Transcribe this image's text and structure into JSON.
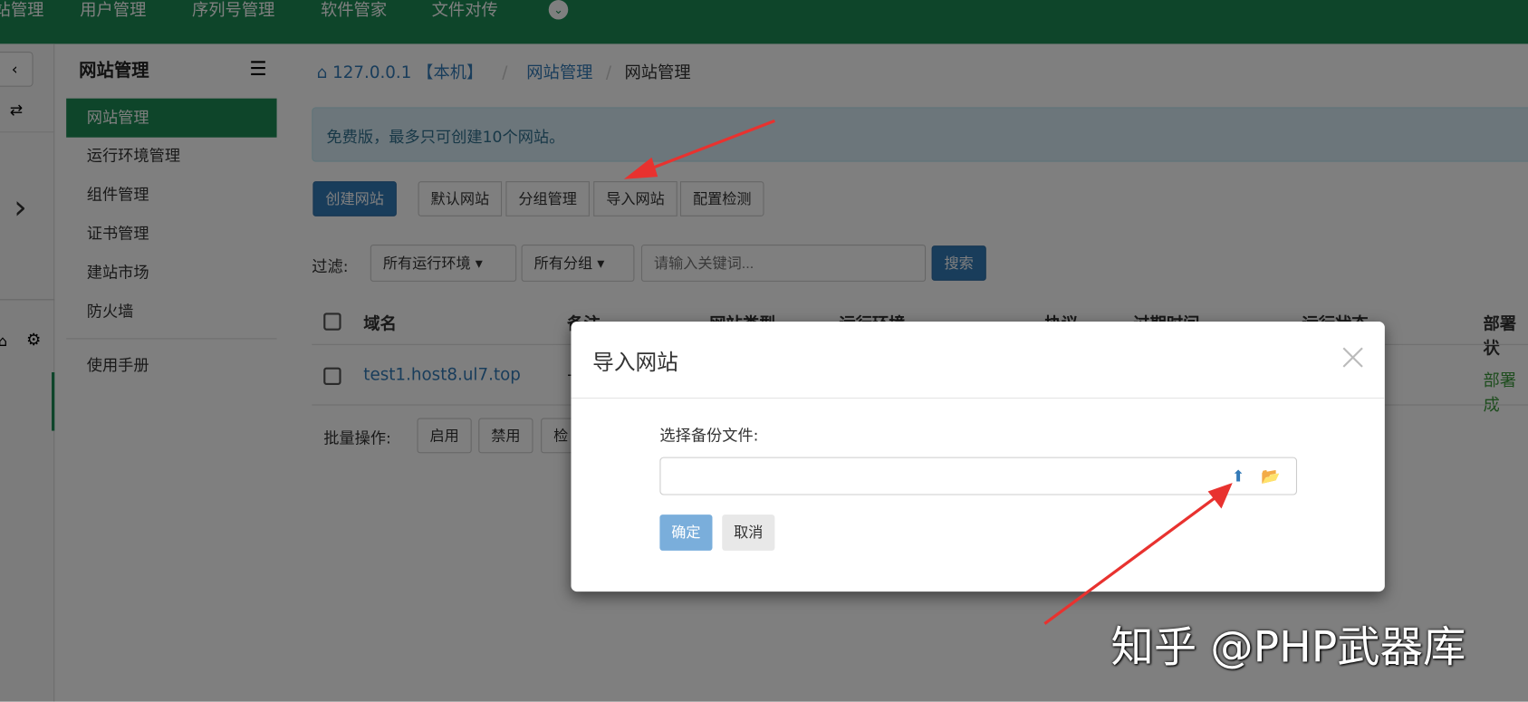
{
  "topnav": {
    "items": [
      "站管理",
      "用户管理",
      "序列号管理",
      "软件管家",
      "文件对传"
    ]
  },
  "sidebar": {
    "title": "网站管理",
    "items": [
      "网站管理",
      "运行环境管理",
      "组件管理",
      "证书管理",
      "建站市场",
      "防火墙",
      "使用手册"
    ]
  },
  "breadcrumb": {
    "host": "127.0.0.1 【本机】",
    "sep": "/",
    "section": "网站管理",
    "current": "网站管理"
  },
  "alert": "免费版，最多只可创建10个网站。",
  "toolbar": {
    "create": "创建网站",
    "buttons": [
      "默认网站",
      "分组管理",
      "导入网站",
      "配置检测"
    ]
  },
  "filter": {
    "label": "过滤:",
    "env": "所有运行环境",
    "group": "所有分组",
    "search_placeholder": "请输入关键词...",
    "search": "搜索"
  },
  "table": {
    "headers": [
      "域名",
      "备注",
      "网站类型",
      "运行环境",
      "协议",
      "过期时间",
      "运行状态",
      "部署状"
    ],
    "rows": [
      {
        "domain": "test1.host8.ul7.top",
        "note": "-",
        "status": "部署成"
      }
    ]
  },
  "batch": {
    "label": "批量操作:",
    "buttons": [
      "启用",
      "禁用",
      "检"
    ]
  },
  "modal": {
    "title": "导入网站",
    "close": "×",
    "file_label": "选择备份文件:",
    "file_value": "",
    "ok": "确定",
    "cancel": "取消"
  },
  "watermark": "知乎 @PHP武器库",
  "colors": {
    "brand": "#1c8a55",
    "primary": "#337ab7",
    "arrow": "#e8322f"
  }
}
